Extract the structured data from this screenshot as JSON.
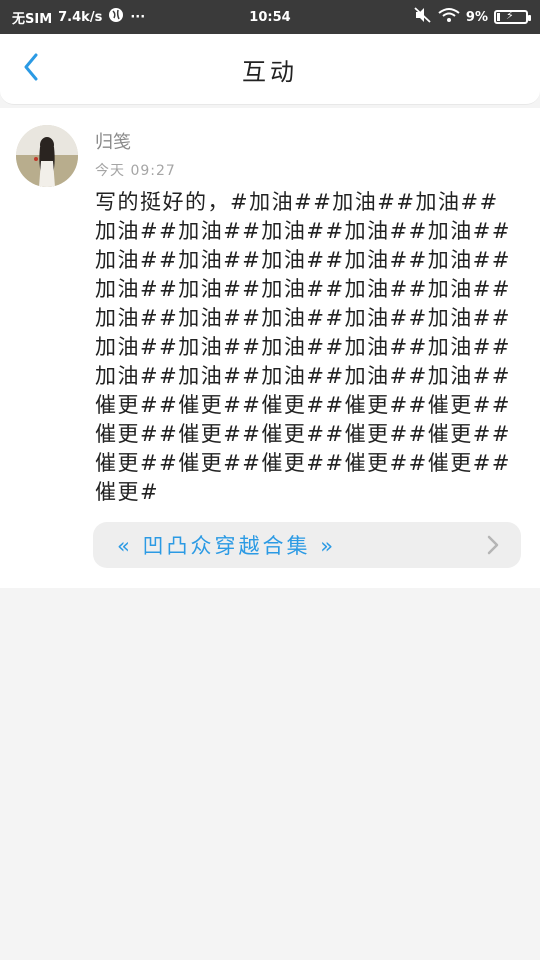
{
  "status_bar": {
    "carrier": "无SIM",
    "speed": "7.4k/s",
    "time": "10:54",
    "battery": "9%",
    "more": "···"
  },
  "header": {
    "title": "互动"
  },
  "comment": {
    "username": "归笺",
    "timestamp": "今天 09:27",
    "text": "写的挺好的，#加油##加油##加油##加油##加油##加油##加油##加油##加油##加油##加油##加油##加油##加油##加油##加油##加油##加油##加油##加油##加油##加油##加油##加油##加油##加油##加油##加油##加油##加油##加油##加油##加油##催更##催更##催更##催更##催更##催更##催更##催更##催更##催更##催更##催更##催更##催更##催更##催更#",
    "book_link": "« 凹凸众穿越合集 »"
  },
  "colors": {
    "accent": "#2b9ae4",
    "status_bar_bg": "#3a3a3a",
    "page_bg": "#f4f4f4"
  }
}
